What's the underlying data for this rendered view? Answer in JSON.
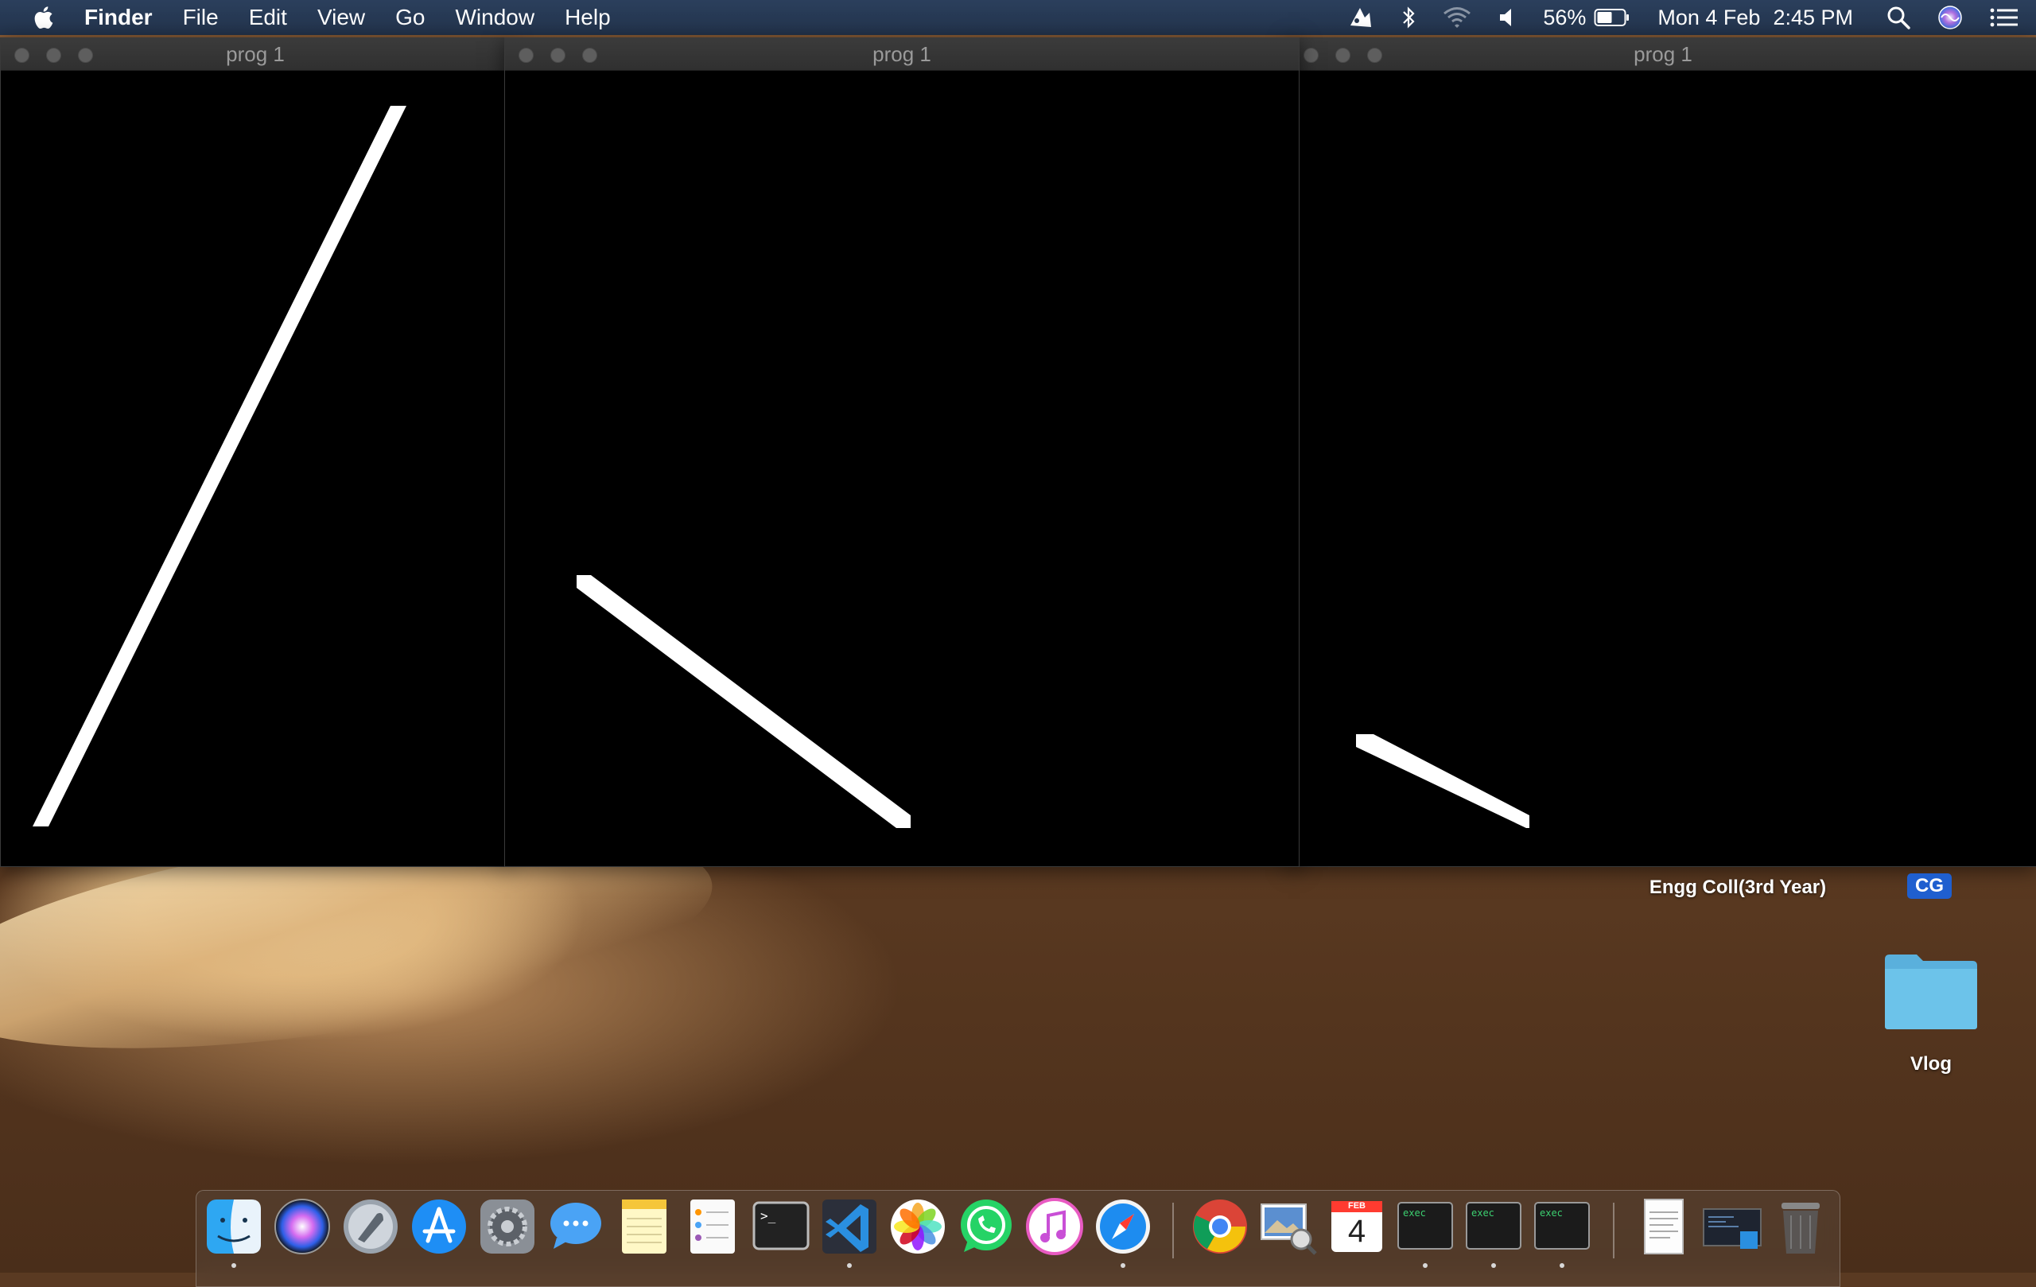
{
  "menubar": {
    "app_name": "Finder",
    "menus": [
      "File",
      "Edit",
      "View",
      "Go",
      "Window",
      "Help"
    ],
    "battery_percent": "56%",
    "date": "Mon 4 Feb",
    "time": "2:45 PM"
  },
  "windows": [
    {
      "title": "prog 1",
      "line": {
        "from": [
          0.05,
          0.92
        ],
        "to": [
          0.79,
          0.0
        ]
      }
    },
    {
      "title": "prog 1",
      "line": {
        "from": [
          0.09,
          0.6
        ],
        "to": [
          0.51,
          0.92
        ]
      }
    },
    {
      "title": "prog 1",
      "line": {
        "from": [
          0.07,
          0.8
        ],
        "to": [
          0.27,
          0.92
        ]
      }
    }
  ],
  "desktop": {
    "items": [
      {
        "label": "Engg Coll(3rd Year)"
      },
      {
        "label": "CG"
      },
      {
        "label": "Vlog"
      }
    ]
  },
  "dock": {
    "items": [
      {
        "name": "Finder",
        "icon": "finder-icon"
      },
      {
        "name": "Siri",
        "icon": "siri-icon"
      },
      {
        "name": "Launchpad",
        "icon": "launchpad-icon"
      },
      {
        "name": "App Store",
        "icon": "app-store-icon"
      },
      {
        "name": "System Preferences",
        "icon": "system-preferences-icon"
      },
      {
        "name": "Messages",
        "icon": "messages-icon"
      },
      {
        "name": "Notes",
        "icon": "notes-icon"
      },
      {
        "name": "Reminders",
        "icon": "reminders-icon"
      },
      {
        "name": "Terminal",
        "icon": "terminal-icon"
      },
      {
        "name": "Visual Studio Code",
        "icon": "vscode-icon"
      },
      {
        "name": "Photos",
        "icon": "photos-icon"
      },
      {
        "name": "WhatsApp",
        "icon": "whatsapp-icon"
      },
      {
        "name": "iTunes",
        "icon": "itunes-icon"
      },
      {
        "name": "Safari",
        "icon": "safari-icon"
      },
      {
        "name": "Google Chrome",
        "icon": "chrome-icon"
      },
      {
        "name": "Preview",
        "icon": "preview-icon"
      },
      {
        "name": "Calendar",
        "icon": "calendar-icon",
        "month": "FEB",
        "day": "4"
      },
      {
        "name": "exec",
        "icon": "exec-icon",
        "label": "exec"
      },
      {
        "name": "exec",
        "icon": "exec-icon",
        "label": "exec"
      },
      {
        "name": "exec",
        "icon": "exec-icon",
        "label": "exec"
      },
      {
        "name": "Document",
        "icon": "document-icon"
      },
      {
        "name": "Screenshot",
        "icon": "screenshot-icon"
      },
      {
        "name": "Trash",
        "icon": "trash-icon"
      }
    ]
  },
  "colors": {
    "menubar": "#23344d",
    "window_bg": "#000000",
    "line": "#ffffff",
    "accent": "#1f5fcf"
  }
}
